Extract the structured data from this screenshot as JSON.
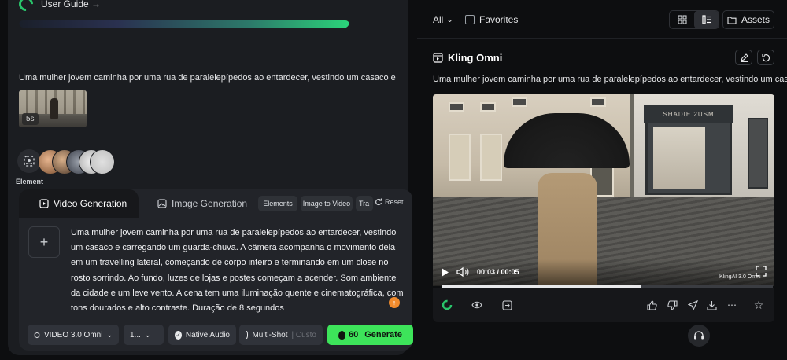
{
  "left": {
    "user_guide": "User Guide →",
    "prompt_preview": "Uma mulher jovem caminha por uma rua de paralelepípedos ao entardecer, vestindo um casaco e",
    "thumb_duration": "5s",
    "element_label": "Element"
  },
  "composer": {
    "tab_video": "Video Generation",
    "tab_image": "Image Generation",
    "chip_elements": "Elements",
    "chip_i2v": "Image to Video",
    "chip_tr": "Tra",
    "reset": "Reset",
    "prompt": "Uma mulher jovem caminha por uma rua de paralelepípedos ao entardecer, vestindo um casaco e carregando um guarda-chuva. A câmera acompanha o movimento dela em um travelling lateral, começando de corpo inteiro e terminando em um close no rosto sorrindo. Ao fundo, luzes de lojas e postes começam a acender. Som ambiente da cidade e um leve vento. A cena tem uma iluminação quente e cinematográfica, com tons dourados e alto contraste. Duração de 8 segundos",
    "model": "VIDEO 3.0 Omni",
    "count": "1...",
    "native_audio": "Native Audio",
    "multi_shot": "Multi-Shot",
    "custom": "Custo",
    "credits": "60",
    "generate": "Generate"
  },
  "right": {
    "filter_all": "All",
    "favorites": "Favorites",
    "assets": "Assets",
    "title": "Kling Omni",
    "prompt": "Uma mulher jovem caminha por uma rua de paralelepípedos ao entardecer, vestindo um casaco",
    "shop_sign": "SHADIE 2USM",
    "time": "00:03 / 00:05",
    "watermark": "KlingAI 3.0 Omni",
    "progress": 0.6
  },
  "colors": {
    "accent_green": "#3de45a",
    "orange": "#f08a2c",
    "panel": "#1b1d21",
    "bg": "#0d0e10"
  }
}
